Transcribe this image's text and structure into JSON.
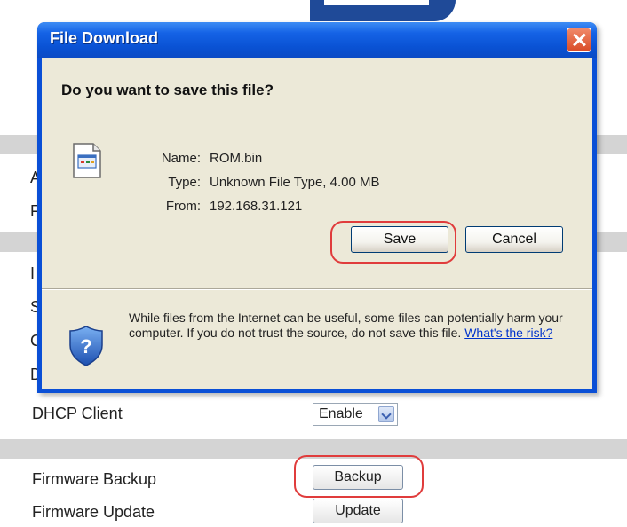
{
  "dialog": {
    "title": "File Download",
    "question": "Do you want to save this file?",
    "name_label": "Name:",
    "name_value": "ROM.bin",
    "type_label": "Type:",
    "type_value": "Unknown File Type, 4.00 MB",
    "from_label": "From:",
    "from_value": "192.168.31.121",
    "save_label": "Save",
    "cancel_label": "Cancel",
    "warning_text": "While files from the Internet can be useful, some files can potentially harm your computer. If you do not trust the source, do not save this file.",
    "risk_link": "What's the risk?"
  },
  "page": {
    "partial_letters": [
      "A",
      "F",
      "I",
      "S",
      "C",
      "D"
    ],
    "dhcp_label": "DHCP Client",
    "dhcp_value": "Enable",
    "backup_label": "Firmware Backup",
    "backup_button": "Backup",
    "update_label": "Firmware Update",
    "update_button": "Update"
  },
  "colors": {
    "titlebar": "#0a52d4",
    "dialog_body": "#ece9d8",
    "highlight_oval": "#e03c3c",
    "band_gray": "#d4d4d4",
    "logo_blue": "#1f4a98"
  }
}
